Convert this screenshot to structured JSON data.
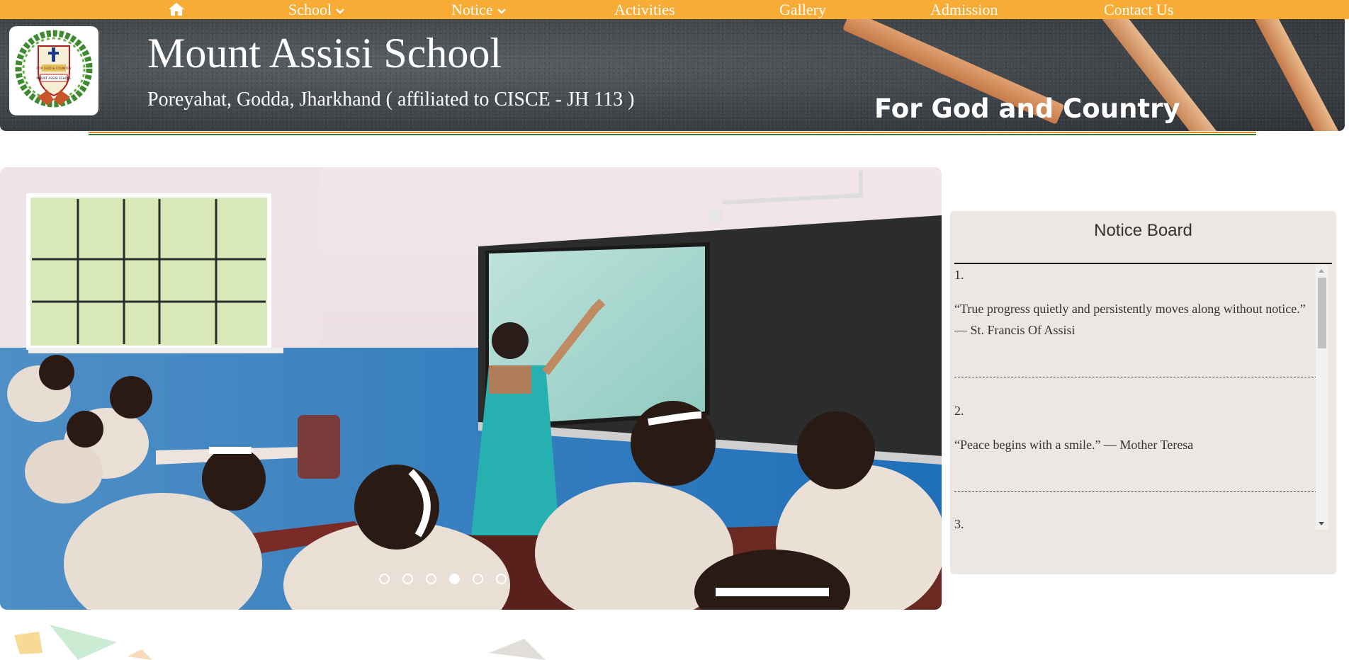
{
  "nav": {
    "home_icon": "home-icon",
    "items": [
      {
        "label": "School",
        "has_dropdown": true
      },
      {
        "label": "Notice",
        "has_dropdown": true
      },
      {
        "label": "Activities",
        "has_dropdown": false
      },
      {
        "label": "Gallery",
        "has_dropdown": false
      },
      {
        "label": "Admission",
        "has_dropdown": false
      },
      {
        "label": "Contact Us",
        "has_dropdown": false
      }
    ],
    "bg_color": "#f9ac35"
  },
  "header": {
    "school_name": "Mount Assisi School",
    "subtitle": "Poreyahat, Godda, Jharkhand ( affiliated to CISCE - JH 113 )",
    "motto": "For God and Country",
    "logo_text": "FOR GOD & COUNTRY",
    "logo_banner": "MOUNT ASSISI SCHOOL"
  },
  "slider": {
    "slide_count": 6,
    "active_index": 3
  },
  "notice_board": {
    "title": "Notice Board",
    "items": [
      {
        "number": "1.",
        "text": "“True progress quietly and persistently moves along without notice.” — St. Francis Of Assisi"
      },
      {
        "number": "2.",
        "text": "“Peace begins with a smile.” — Mother Teresa"
      },
      {
        "number": "3.",
        "text": ""
      }
    ]
  }
}
